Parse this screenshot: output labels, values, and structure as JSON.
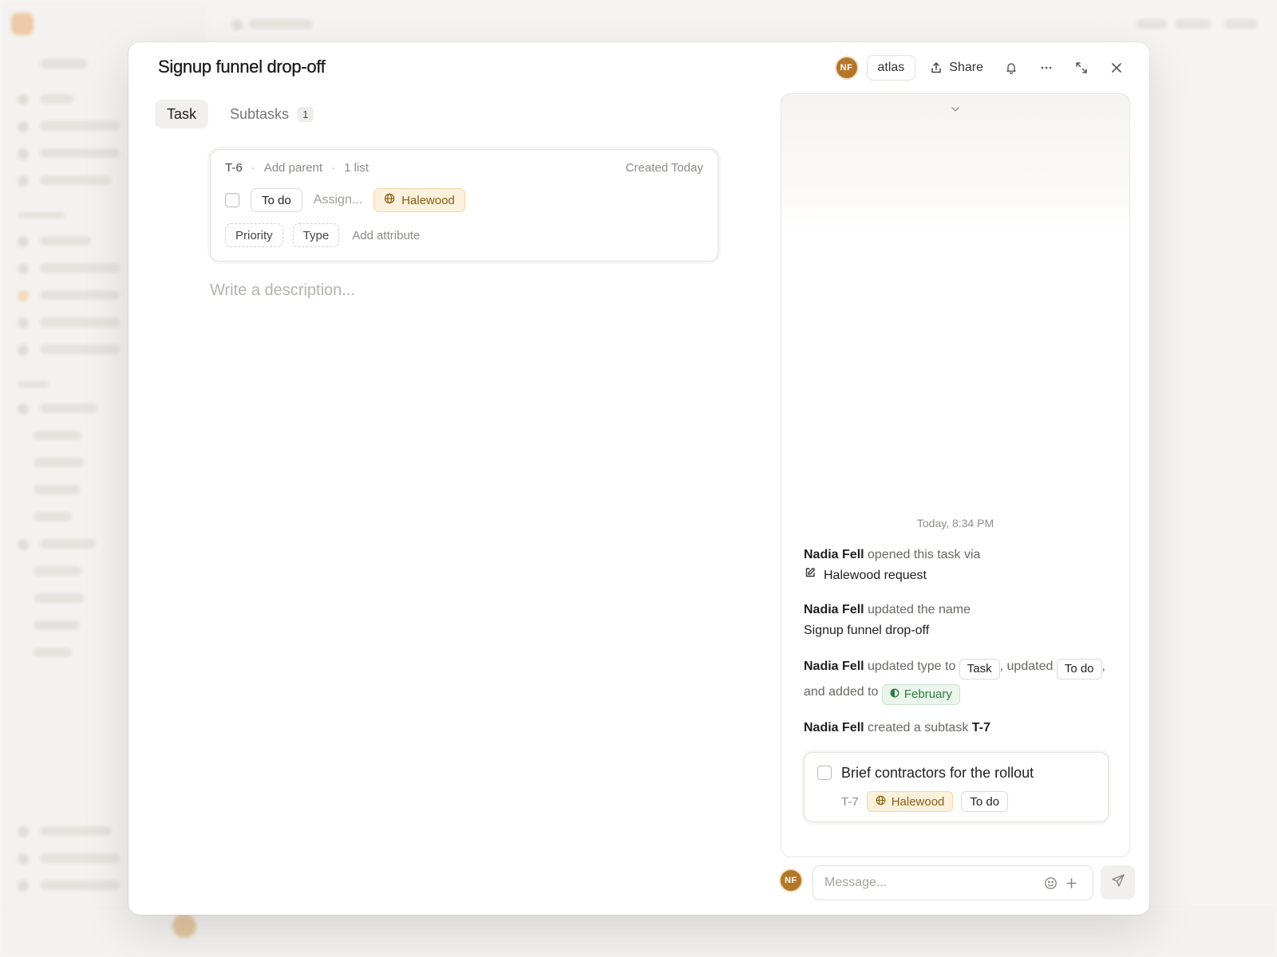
{
  "task": {
    "title": "Signup funnel drop-off",
    "id": "T-6",
    "add_parent_label": "Add parent",
    "list_count_label": "1 list",
    "created_label": "Created Today",
    "status": "To do",
    "assign_placeholder": "Assign...",
    "project": "Halewood",
    "priority_label": "Priority",
    "type_label": "Type",
    "add_attribute_label": "Add attribute",
    "description_placeholder": "Write a description..."
  },
  "header": {
    "avatar_initials": "NF",
    "workspace_label": "atlas",
    "share_label": "Share",
    "icons": [
      "share-icon",
      "bell-icon",
      "more-icon",
      "expand-icon",
      "close-icon"
    ]
  },
  "tabs": [
    {
      "label": "Task",
      "active": true
    },
    {
      "label": "Subtasks",
      "count": "1",
      "active": false
    }
  ],
  "activity": {
    "timestamp": "Today, 8:34 PM",
    "items": [
      {
        "user": "Nadia Fell",
        "text": "opened this task via",
        "target": "Halewood request"
      },
      {
        "user": "Nadia Fell",
        "text": "updated the name",
        "target": "Signup funnel drop-off"
      },
      {
        "user": "Nadia Fell",
        "text1": "updated type to",
        "chip1": "Task",
        "text2": ", updated",
        "chip2": "To do",
        "text3": ", and added to",
        "chip3": "February"
      },
      {
        "user": "Nadia Fell",
        "text": "created a subtask",
        "target": "T-7"
      }
    ],
    "subtask": {
      "title": "Brief contractors for the rollout",
      "id": "T-7",
      "project": "Halewood",
      "status": "To do"
    }
  },
  "composer": {
    "avatar_initials": "NF",
    "placeholder": "Message..."
  },
  "colors": {
    "avatar": "#b3762b",
    "project_chip_bg": "#fbf1dc",
    "project_chip_text": "#8a5d12",
    "cycle_chip_bg": "#eaf5ec",
    "cycle_chip_text": "#2f7a3e"
  }
}
